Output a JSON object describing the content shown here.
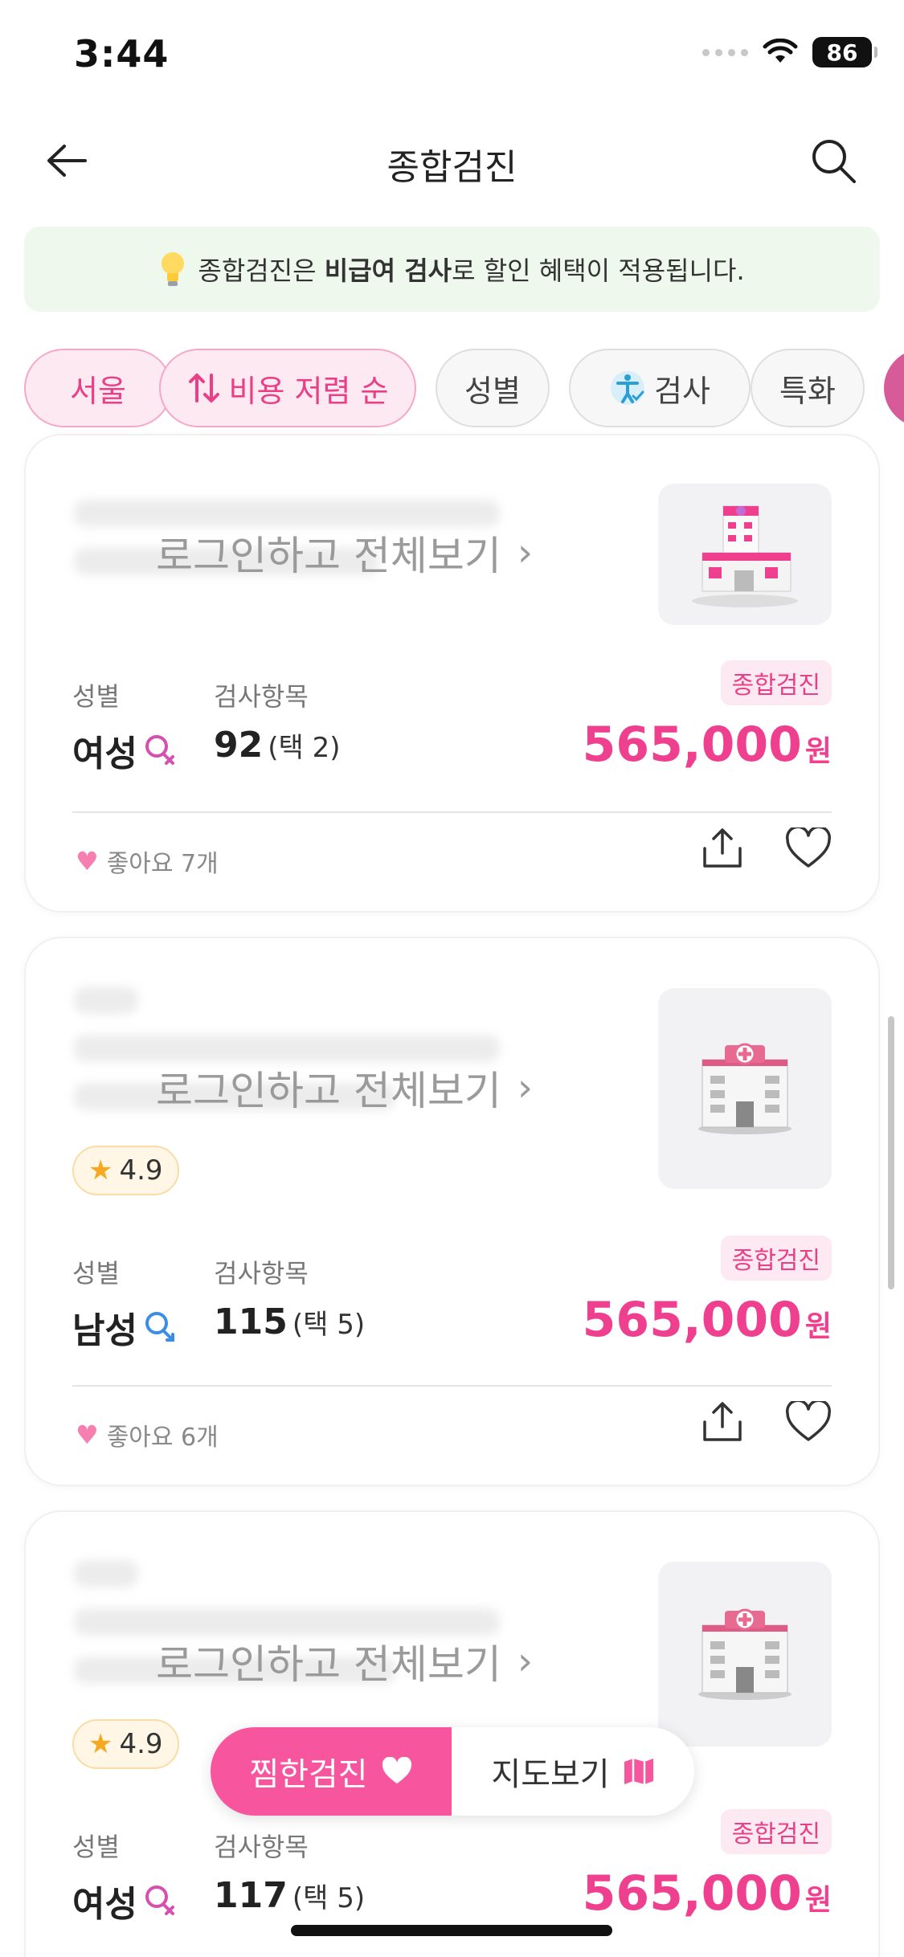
{
  "status": {
    "time": "3:44",
    "battery": "86"
  },
  "nav": {
    "title": "종합검진"
  },
  "notice": {
    "prefix": "종합검진은 ",
    "bold": "비급여 검사",
    "suffix": "로 할인 혜택이 적용됩니다."
  },
  "filters": [
    {
      "label": "서울"
    },
    {
      "label": "비용 저렴 순"
    },
    {
      "label": "성별"
    },
    {
      "label": "검사"
    },
    {
      "label": "특화"
    }
  ],
  "cards": [
    {
      "login_text": "로그인하고 전체보기",
      "gender_label": "성별",
      "gender_value": "여성",
      "items_label": "검사항목",
      "items_count": "92",
      "items_choice": "(택 2)",
      "tag": "종합검진",
      "price": "565,000",
      "price_unit": "원",
      "likes": "좋아요 7개"
    },
    {
      "login_text": "로그인하고 전체보기",
      "rating": "4.9",
      "gender_label": "성별",
      "gender_value": "남성",
      "items_label": "검사항목",
      "items_count": "115",
      "items_choice": "(택 5)",
      "tag": "종합검진",
      "price": "565,000",
      "price_unit": "원",
      "likes": "좋아요 6개"
    },
    {
      "login_text": "로그인하고 전체보기",
      "rating": "4.9",
      "gender_label": "성별",
      "gender_value": "여성",
      "items_label": "검사항목",
      "items_count": "117",
      "items_choice": "(택 5)",
      "tag": "종합검진",
      "price": "565,000",
      "price_unit": "원"
    }
  ],
  "floating": {
    "favorites_label": "찜한검진",
    "map_label": "지도보기"
  },
  "colors": {
    "accent": "#ef3f8f",
    "notice_bg": "#eef8ec",
    "chip_active_bg": "#fde9f1",
    "female_icon": "#d64fb0",
    "male_icon": "#3a8ee8"
  }
}
